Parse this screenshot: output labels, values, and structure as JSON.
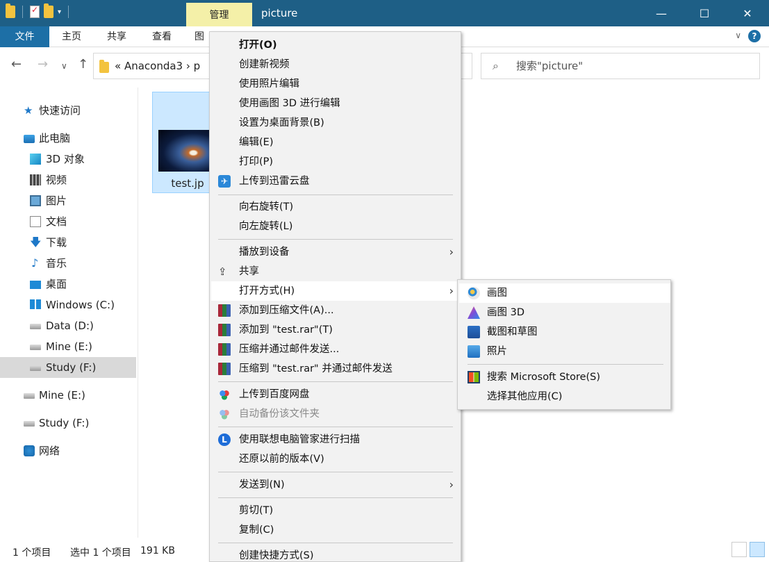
{
  "titlebar": {
    "manage_tab": "管理",
    "title": "picture",
    "minimize": "—",
    "maximize": "☐",
    "close": "✕"
  },
  "ribbon": {
    "tabs": [
      "文件",
      "主页",
      "共享",
      "查看",
      "图"
    ],
    "chevron": "∨",
    "help": "?"
  },
  "address": {
    "back": "←",
    "forward": "→",
    "recent": "∨",
    "up": "↑",
    "path": "«   Anaconda3   ›   p"
  },
  "search": {
    "placeholder": "搜索\"picture\"",
    "icon": "search-icon"
  },
  "sidebar": {
    "items": [
      {
        "label": "快速访问",
        "icon": "star-icon"
      },
      {
        "label": "此电脑",
        "icon": "computer-icon"
      },
      {
        "label": "3D 对象",
        "icon": "cube-icon"
      },
      {
        "label": "视频",
        "icon": "film-icon"
      },
      {
        "label": "图片",
        "icon": "picture-icon"
      },
      {
        "label": "文档",
        "icon": "document-icon"
      },
      {
        "label": "下载",
        "icon": "download-icon"
      },
      {
        "label": "音乐",
        "icon": "music-icon"
      },
      {
        "label": "桌面",
        "icon": "desktop-icon"
      },
      {
        "label": "Windows (C:)",
        "icon": "windows-drive-icon"
      },
      {
        "label": "Data (D:)",
        "icon": "drive-icon"
      },
      {
        "label": "Mine (E:)",
        "icon": "drive-icon"
      },
      {
        "label": "Study (F:)",
        "icon": "drive-icon"
      },
      {
        "label": "Mine (E:)",
        "icon": "drive-icon"
      },
      {
        "label": "Study (F:)",
        "icon": "drive-icon"
      },
      {
        "label": "网络",
        "icon": "network-icon"
      }
    ]
  },
  "content": {
    "file_name": "test.jp"
  },
  "status": {
    "count": "1 个项目",
    "selected": "选中 1 个项目",
    "size": "191 KB"
  },
  "context_menu": {
    "items": [
      {
        "label": "打开(O)"
      },
      {
        "label": "创建新视频"
      },
      {
        "label": "使用照片编辑"
      },
      {
        "label": "使用画图 3D 进行编辑"
      },
      {
        "label": "设置为桌面背景(B)"
      },
      {
        "label": "编辑(E)"
      },
      {
        "label": "打印(P)"
      },
      {
        "label": "上传到迅雷云盘"
      },
      {
        "label": "向右旋转(T)"
      },
      {
        "label": "向左旋转(L)"
      },
      {
        "label": "播放到设备"
      },
      {
        "label": "共享"
      },
      {
        "label": "打开方式(H)"
      },
      {
        "label": "添加到压缩文件(A)..."
      },
      {
        "label": "添加到 \"test.rar\"(T)"
      },
      {
        "label": "压缩并通过邮件发送..."
      },
      {
        "label": "压缩到 \"test.rar\" 并通过邮件发送"
      },
      {
        "label": "上传到百度网盘"
      },
      {
        "label": "自动备份该文件夹"
      },
      {
        "label": "使用联想电脑管家进行扫描"
      },
      {
        "label": "还原以前的版本(V)"
      },
      {
        "label": "发送到(N)"
      },
      {
        "label": "剪切(T)"
      },
      {
        "label": "复制(C)"
      },
      {
        "label": "创建快捷方式(S)"
      }
    ],
    "arrow": "›"
  },
  "open_with": {
    "items": [
      {
        "label": "画图"
      },
      {
        "label": "画图 3D"
      },
      {
        "label": "截图和草图"
      },
      {
        "label": "照片"
      },
      {
        "label": "搜索 Microsoft Store(S)"
      },
      {
        "label": "选择其他应用(C)"
      }
    ]
  },
  "colors": {
    "titlebar": "#1e5f86",
    "manage_tab": "#f4f0a8",
    "file_tab": "#1d6fa6",
    "selection": "#cce8ff",
    "menu_bg": "#f2f2f2"
  }
}
